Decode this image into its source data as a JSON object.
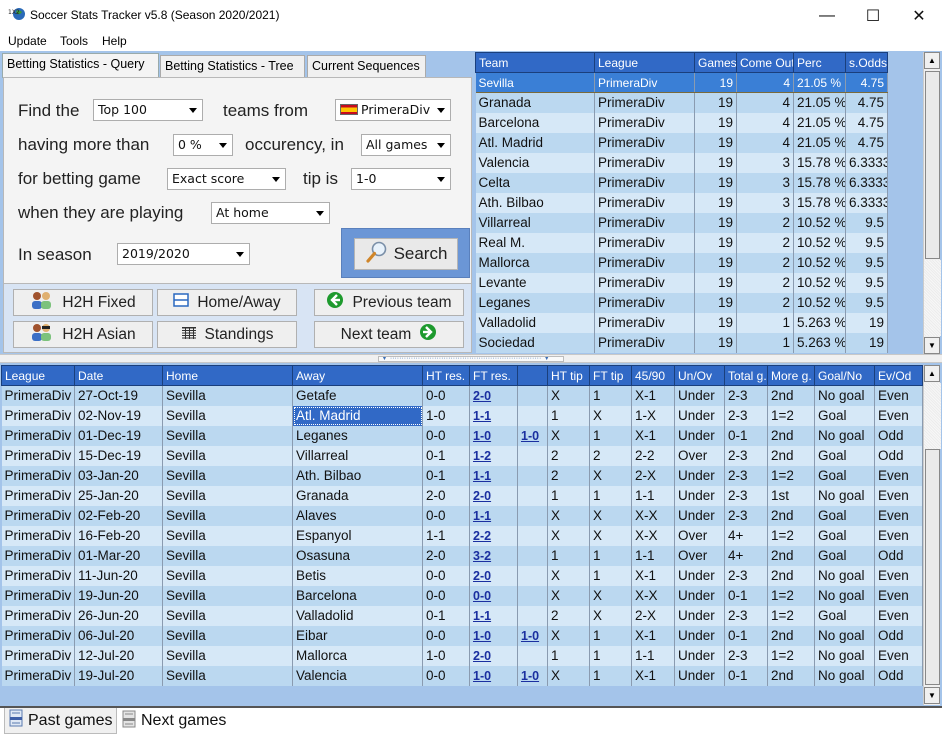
{
  "window": {
    "title": "Soccer Stats Tracker v5.8 (Season 2020/2021)",
    "minimize": "—",
    "maximize": "☐",
    "close": "✕"
  },
  "menu": [
    "Update",
    "Tools",
    "Help"
  ],
  "tabs": [
    {
      "label": "Betting Statistics - Query",
      "active": true
    },
    {
      "label": "Betting Statistics - Tree",
      "active": false
    },
    {
      "label": "Current Sequences",
      "active": false
    }
  ],
  "query": {
    "find_label": "Find the",
    "top_value": "Top 100",
    "teams_from_label": "teams from",
    "league_value": "PrimeraDiv",
    "having_label": "having more than",
    "pct_value": "0 %",
    "occurency_label": "occurency, in",
    "games_value": "All games",
    "betting_label": "for betting game",
    "game_value": "Exact score",
    "tip_label": "tip is",
    "tip_value": "1-0",
    "playing_label": "when they are playing",
    "playing_value": "At home",
    "season_label": "In season",
    "season_value": "2019/2020",
    "search_label": "Search"
  },
  "buttons": {
    "h2h_fixed": "H2H Fixed",
    "home_away": "Home/Away",
    "previous_team": "Previous team",
    "h2h_asian": "H2H Asian",
    "standings": "Standings",
    "next_team": "Next team"
  },
  "teams_table": {
    "columns": [
      "Team",
      "League",
      "Games",
      "Come Out",
      "Perc",
      "s.Odds"
    ],
    "rows": [
      [
        "Sevilla",
        "PrimeraDiv",
        "19",
        "4",
        "21.05 %",
        "4.75"
      ],
      [
        "Granada",
        "PrimeraDiv",
        "19",
        "4",
        "21.05 %",
        "4.75"
      ],
      [
        "Barcelona",
        "PrimeraDiv",
        "19",
        "4",
        "21.05 %",
        "4.75"
      ],
      [
        "Atl. Madrid",
        "PrimeraDiv",
        "19",
        "4",
        "21.05 %",
        "4.75"
      ],
      [
        "Valencia",
        "PrimeraDiv",
        "19",
        "3",
        "15.78 %",
        "6.3333"
      ],
      [
        "Celta",
        "PrimeraDiv",
        "19",
        "3",
        "15.78 %",
        "6.3333"
      ],
      [
        "Ath. Bilbao",
        "PrimeraDiv",
        "19",
        "3",
        "15.78 %",
        "6.3333"
      ],
      [
        "Villarreal",
        "PrimeraDiv",
        "19",
        "2",
        "10.52 %",
        "9.5"
      ],
      [
        "Real M.",
        "PrimeraDiv",
        "19",
        "2",
        "10.52 %",
        "9.5"
      ],
      [
        "Mallorca",
        "PrimeraDiv",
        "19",
        "2",
        "10.52 %",
        "9.5"
      ],
      [
        "Levante",
        "PrimeraDiv",
        "19",
        "2",
        "10.52 %",
        "9.5"
      ],
      [
        "Leganes",
        "PrimeraDiv",
        "19",
        "2",
        "10.52 %",
        "9.5"
      ],
      [
        "Valladolid",
        "PrimeraDiv",
        "19",
        "1",
        "5.263 %",
        "19"
      ],
      [
        "Sociedad",
        "PrimeraDiv",
        "19",
        "1",
        "5.263 %",
        "19"
      ]
    ],
    "selected_row": 0
  },
  "games_table": {
    "columns": [
      "League",
      "Date",
      "Home",
      "Away",
      "HT res.",
      "FT res.",
      "",
      "HT tip",
      "FT tip",
      "45/90",
      "Un/Ov",
      "Total g.",
      "More g.",
      "Goal/No",
      "Ev/Od"
    ],
    "rows": [
      [
        "PrimeraDiv",
        "27-Oct-19",
        "Sevilla",
        "Getafe",
        "0-0",
        "2-0",
        "",
        "X",
        "1",
        "X-1",
        "Under",
        "2-3",
        "2nd",
        "No goal",
        "Even"
      ],
      [
        "PrimeraDiv",
        "02-Nov-19",
        "Sevilla",
        "Atl. Madrid",
        "1-0",
        "1-1",
        "",
        "1",
        "X",
        "1-X",
        "Under",
        "2-3",
        "1=2",
        "Goal",
        "Even"
      ],
      [
        "PrimeraDiv",
        "01-Dec-19",
        "Sevilla",
        "Leganes",
        "0-0",
        "1-0",
        "1-0",
        "X",
        "1",
        "X-1",
        "Under",
        "0-1",
        "2nd",
        "No goal",
        "Odd"
      ],
      [
        "PrimeraDiv",
        "15-Dec-19",
        "Sevilla",
        "Villarreal",
        "0-1",
        "1-2",
        "",
        "2",
        "2",
        "2-2",
        "Over",
        "2-3",
        "2nd",
        "Goal",
        "Odd"
      ],
      [
        "PrimeraDiv",
        "03-Jan-20",
        "Sevilla",
        "Ath. Bilbao",
        "0-1",
        "1-1",
        "",
        "2",
        "X",
        "2-X",
        "Under",
        "2-3",
        "1=2",
        "Goal",
        "Even"
      ],
      [
        "PrimeraDiv",
        "25-Jan-20",
        "Sevilla",
        "Granada",
        "2-0",
        "2-0",
        "",
        "1",
        "1",
        "1-1",
        "Under",
        "2-3",
        "1st",
        "No goal",
        "Even"
      ],
      [
        "PrimeraDiv",
        "02-Feb-20",
        "Sevilla",
        "Alaves",
        "0-0",
        "1-1",
        "",
        "X",
        "X",
        "X-X",
        "Under",
        "2-3",
        "2nd",
        "Goal",
        "Even"
      ],
      [
        "PrimeraDiv",
        "16-Feb-20",
        "Sevilla",
        "Espanyol",
        "1-1",
        "2-2",
        "",
        "X",
        "X",
        "X-X",
        "Over",
        "4+",
        "1=2",
        "Goal",
        "Even"
      ],
      [
        "PrimeraDiv",
        "01-Mar-20",
        "Sevilla",
        "Osasuna",
        "2-0",
        "3-2",
        "",
        "1",
        "1",
        "1-1",
        "Over",
        "4+",
        "2nd",
        "Goal",
        "Odd"
      ],
      [
        "PrimeraDiv",
        "11-Jun-20",
        "Sevilla",
        "Betis",
        "0-0",
        "2-0",
        "",
        "X",
        "1",
        "X-1",
        "Under",
        "2-3",
        "2nd",
        "No goal",
        "Even"
      ],
      [
        "PrimeraDiv",
        "19-Jun-20",
        "Sevilla",
        "Barcelona",
        "0-0",
        "0-0",
        "",
        "X",
        "X",
        "X-X",
        "Under",
        "0-1",
        "1=2",
        "No goal",
        "Even"
      ],
      [
        "PrimeraDiv",
        "26-Jun-20",
        "Sevilla",
        "Valladolid",
        "0-1",
        "1-1",
        "",
        "2",
        "X",
        "2-X",
        "Under",
        "2-3",
        "1=2",
        "Goal",
        "Even"
      ],
      [
        "PrimeraDiv",
        "06-Jul-20",
        "Sevilla",
        "Eibar",
        "0-0",
        "1-0",
        "1-0",
        "X",
        "1",
        "X-1",
        "Under",
        "0-1",
        "2nd",
        "No goal",
        "Odd"
      ],
      [
        "PrimeraDiv",
        "12-Jul-20",
        "Sevilla",
        "Mallorca",
        "1-0",
        "2-0",
        "",
        "1",
        "1",
        "1-1",
        "Under",
        "2-3",
        "1=2",
        "No goal",
        "Even"
      ],
      [
        "PrimeraDiv",
        "19-Jul-20",
        "Sevilla",
        "Valencia",
        "0-0",
        "1-0",
        "1-0",
        "X",
        "1",
        "X-1",
        "Under",
        "0-1",
        "2nd",
        "No goal",
        "Odd"
      ]
    ],
    "selected_cell": {
      "row": 1,
      "col": 3
    },
    "link_columns": [
      5,
      6
    ]
  },
  "bottom_tabs": [
    {
      "label": "Past games",
      "active": true
    },
    {
      "label": "Next games",
      "active": false
    }
  ]
}
